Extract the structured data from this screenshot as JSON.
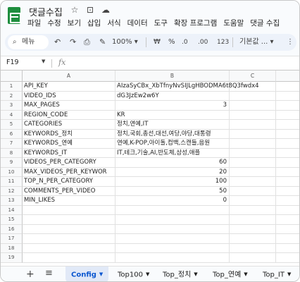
{
  "doc": {
    "title": "댓글수집"
  },
  "menu": [
    "파일",
    "수정",
    "보기",
    "삽입",
    "서식",
    "데이터",
    "도구",
    "확장 프로그램",
    "도움말",
    "댓글 수집"
  ],
  "toolbar": {
    "search_label": "메뉴",
    "zoom": "100%",
    "currency": "₩",
    "percent": "%",
    "dec_decrease": ".0",
    "dec_increase": ".00",
    "number_format": "123",
    "font": "기본값 ..."
  },
  "formula": {
    "cell_ref": "F19",
    "fx": "fx",
    "content": ""
  },
  "columns": [
    "A",
    "B",
    "C"
  ],
  "rows": [
    {
      "n": "1",
      "a": "API_KEY",
      "b": "AIzaSyCBx_XbTfnyNvSIJLgHBODMA6t8Q3fwdx4",
      "b_num": false
    },
    {
      "n": "2",
      "a": "VIDEO_IDS",
      "b": "dG3JzEw2w6Y",
      "b_num": false
    },
    {
      "n": "3",
      "a": "MAX_PAGES",
      "b": "3",
      "b_num": true
    },
    {
      "n": "4",
      "a": "REGION_CODE",
      "b": "KR",
      "b_num": false
    },
    {
      "n": "5",
      "a": "CATEGORIES",
      "b": "정치,연예,IT",
      "b_num": false
    },
    {
      "n": "6",
      "a": "KEYWORDS_정치",
      "b": "정치,국회,총선,대선,여당,야당,대통령",
      "b_num": false
    },
    {
      "n": "7",
      "a": "KEYWORDS_연예",
      "b": "연예,K-POP,아이돌,컴백,스캔들,음원",
      "b_num": false
    },
    {
      "n": "8",
      "a": "KEYWORDS_IT",
      "b": "IT,테크,기술,AI,반도체,삼성,애플",
      "b_num": false
    },
    {
      "n": "9",
      "a": "VIDEOS_PER_CATEGORY",
      "b": "60",
      "b_num": true
    },
    {
      "n": "10",
      "a": "MAX_VIDEOS_PER_KEYWOR",
      "b": "20",
      "b_num": true
    },
    {
      "n": "11",
      "a": "TOP_N_PER_CATEGORY",
      "b": "100",
      "b_num": true
    },
    {
      "n": "12",
      "a": "COMMENTS_PER_VIDEO",
      "b": "50",
      "b_num": true
    },
    {
      "n": "13",
      "a": "MIN_LIKES",
      "b": "0",
      "b_num": true
    },
    {
      "n": "14",
      "a": "",
      "b": "",
      "b_num": false
    },
    {
      "n": "15",
      "a": "",
      "b": "",
      "b_num": false
    },
    {
      "n": "16",
      "a": "",
      "b": "",
      "b_num": false
    },
    {
      "n": "17",
      "a": "",
      "b": "",
      "b_num": false
    },
    {
      "n": "18",
      "a": "",
      "b": "",
      "b_num": false
    },
    {
      "n": "19",
      "a": "",
      "b": "",
      "b_num": false
    }
  ],
  "sheets": [
    {
      "label": "Config",
      "active": true
    },
    {
      "label": "Top100",
      "active": false
    },
    {
      "label": "Top_정치",
      "active": false
    },
    {
      "label": "Top_연예",
      "active": false
    },
    {
      "label": "Top_IT",
      "active": false
    }
  ],
  "colors": {
    "logo_green": "#1e8e3e",
    "active_tab_text": "#0b57d0",
    "active_tab_bg": "#e1e9f7",
    "toolbar_bg": "#edf2fa"
  }
}
